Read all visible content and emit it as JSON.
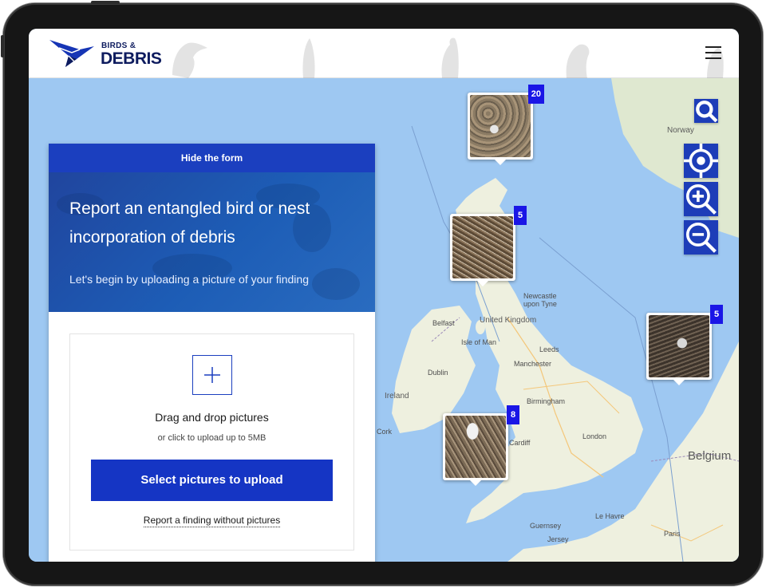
{
  "brand": {
    "small": "BIRDS &",
    "big": "DEBRIS"
  },
  "header": {
    "menu_icon": "hamburger-menu-icon"
  },
  "form": {
    "toggle_label": "Hide the form",
    "title": "Report an entangled bird or nest incorporation of debris",
    "subtitle": "Let's begin by uploading a picture of your finding",
    "drop_title": "Drag and drop pictures",
    "drop_subtitle": "or click to upload up to 5MB",
    "select_button": "Select pictures to upload",
    "no_pictures_link": "Report a finding without pictures"
  },
  "map_controls": [
    {
      "name": "search-button",
      "icon": "search-icon"
    },
    {
      "name": "locate-button",
      "icon": "crosshair-icon"
    },
    {
      "name": "zoom-in-button",
      "icon": "zoom-in-icon"
    },
    {
      "name": "zoom-out-button",
      "icon": "zoom-out-icon"
    }
  ],
  "markers": [
    {
      "count": "20",
      "photo": "seabird-on-debris-beach"
    },
    {
      "count": "5",
      "photo": "nest-with-netting"
    },
    {
      "count": "5",
      "photo": "entangled-bird"
    },
    {
      "count": "8",
      "photo": "gull-on-debris-nest"
    }
  ],
  "map_labels": {
    "norway": "Norway",
    "belfast": "Belfast",
    "isle_of_man": "Isle of Man",
    "united_kingdom": "United Kingdom",
    "newcastle": "Newcastle upon Tyne",
    "leeds": "Leeds",
    "manchester": "Manchester",
    "dublin": "Dublin",
    "ireland": "Ireland",
    "birmingham": "Birmingham",
    "cork": "Cork",
    "cardiff": "Cardiff",
    "london": "London",
    "belgium": "Belgium",
    "le_havre": "Le Havre",
    "guernsey": "Guernsey",
    "jersey": "Jersey",
    "paris": "Paris"
  },
  "colors": {
    "sea": "#9ec8f2",
    "land": "#eef0df",
    "accent": "#1b3fbf",
    "badge": "#1a16e6"
  }
}
